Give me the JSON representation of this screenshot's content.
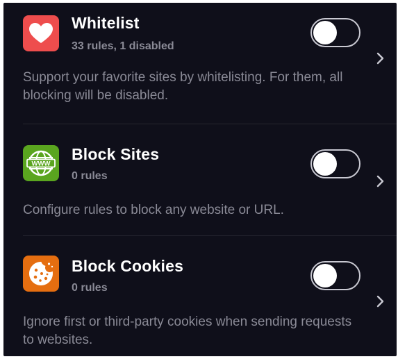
{
  "settings": {
    "items": [
      {
        "title": "Whitelist",
        "subtitle": "33 rules, 1 disabled",
        "description": "Support your favorite sites by whitelisting. For them, all blocking will be disabled.",
        "icon": "heart-icon",
        "icon_color": "#ee4d4d",
        "enabled": false
      },
      {
        "title": "Block Sites",
        "subtitle": "0 rules",
        "description": "Configure rules to block any website or URL.",
        "icon": "www-globe-icon",
        "icon_color": "#5aa51f",
        "enabled": false
      },
      {
        "title": "Block Cookies",
        "subtitle": "0 rules",
        "description": "Ignore first or third-party cookies when sending requests to websites.",
        "icon": "cookie-icon",
        "icon_color": "#e56e10",
        "enabled": false
      }
    ]
  }
}
